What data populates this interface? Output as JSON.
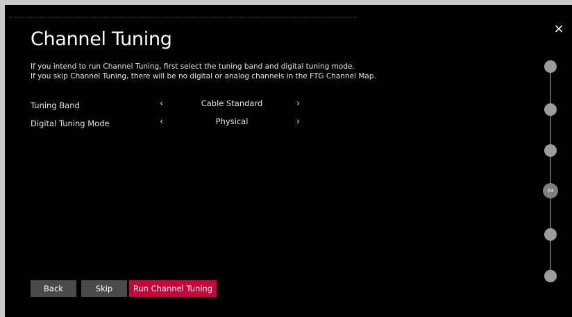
{
  "dialog": {
    "title": "Channel Tuning",
    "description_line1": "If you intend to run Channel Tuning, first select the tuning band and digital tuning mode.",
    "description_line2": "If you skip Channel Tuning, there will be no digital or analog channels in the FTG Channel Map.",
    "close_icon": "×"
  },
  "settings": [
    {
      "label": "Tuning Band",
      "value": "Cable Standard",
      "prev_icon": "‹",
      "next_icon": "›"
    },
    {
      "label": "Digital Tuning Mode",
      "value": "Physical",
      "prev_icon": "‹",
      "next_icon": "›"
    }
  ],
  "buttons": {
    "back": "Back",
    "skip": "Skip",
    "run": "Run Channel Tuning"
  },
  "steps": {
    "current_label": "04",
    "current_index": 4,
    "total": 6
  },
  "colors": {
    "accent": "#c6053c",
    "secondary_button": "#4a4a4a",
    "background": "#000000"
  }
}
